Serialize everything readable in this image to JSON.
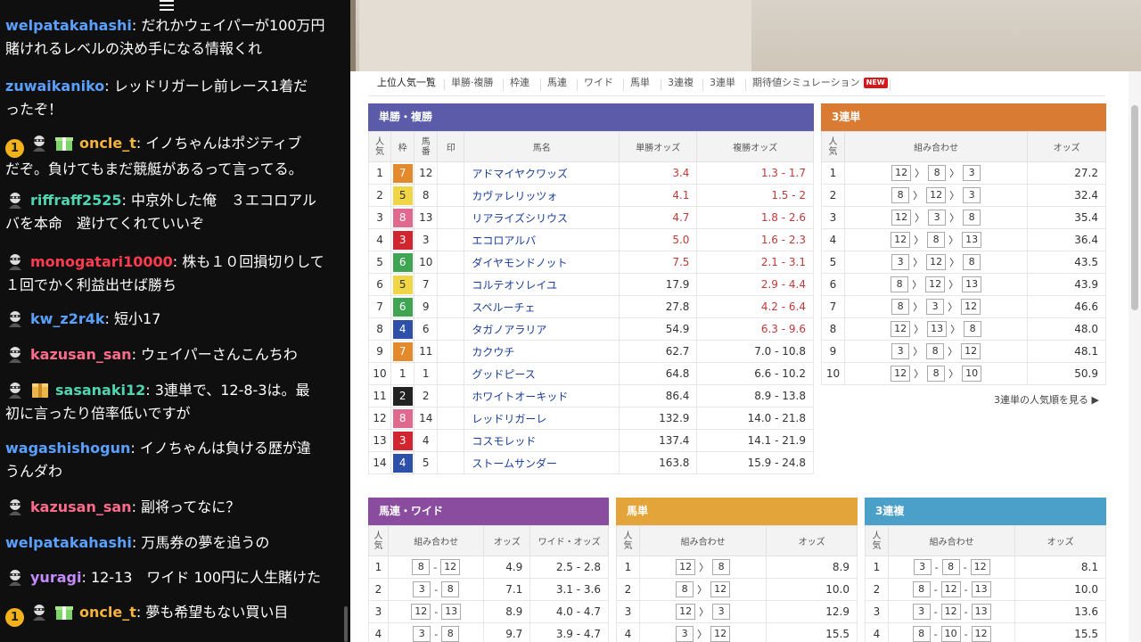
{
  "chat": {
    "messages": [
      {
        "badges": [],
        "user": "welpatakahashi",
        "color": "#5aa0ff",
        "lines": [
          "だれかウェイパーが100万円",
          "賭けれるレベルの決め手になる情報くれ"
        ]
      },
      {
        "badges": [],
        "user": "zuwaikaniko",
        "color": "#5aa0ff",
        "lines": [
          "レッドリガーレ前レース1着だ",
          "ったぞ！"
        ]
      },
      {
        "badges": [
          "1",
          "ninja",
          "gift"
        ],
        "user": "oncle_t",
        "color": "#f5b33b",
        "lines": [
          "イノちゃんはポジティブ",
          "だぞ。負けてもまだ競艇があるって言ってる。"
        ]
      },
      {
        "badges": [
          "ninja"
        ],
        "user": "riffraff2525",
        "color": "#4fd6b0",
        "lines": [
          "中京外した俺　３エコロアル",
          "バを本命　避けてくれていいぞ"
        ]
      },
      {
        "badges": [
          "ninja"
        ],
        "user": "monogatari10000",
        "color": "#ff3b4f",
        "lines": [
          "株も１０回損切りして",
          "１回でかく利益出せば勝ち"
        ]
      },
      {
        "badges": [
          "ninja"
        ],
        "user": "kw_z2r4k",
        "color": "#5aa0ff",
        "lines": [
          "短小17"
        ]
      },
      {
        "badges": [
          "ninja"
        ],
        "user": "kazusan_san",
        "color": "#ff6b8b",
        "lines": [
          "ウェイパーさんこんちわ"
        ]
      },
      {
        "badges": [
          "ninja",
          "box"
        ],
        "user": "sasanaki12",
        "color": "#4fd6b0",
        "lines": [
          "3連単で、12-8-3は。最",
          "初に言ったり倍率低いですが"
        ]
      },
      {
        "badges": [],
        "user": "wagashishogun",
        "color": "#5aa0ff",
        "lines": [
          "イノちゃんは負ける歴が違",
          "うんダわ"
        ]
      },
      {
        "badges": [
          "ninja"
        ],
        "user": "kazusan_san",
        "color": "#ff6b8b",
        "lines": [
          "副将ってなに？"
        ]
      },
      {
        "badges": [],
        "user": "welpatakahashi",
        "color": "#5aa0ff",
        "lines": [
          "万馬券の夢を追うの"
        ]
      },
      {
        "badges": [
          "ninja"
        ],
        "user": "yuragi",
        "color": "#c48bff",
        "lines": [
          "12-13　ワイド 100円に人生賭けた"
        ]
      },
      {
        "badges": [
          "1",
          "ninja",
          "gift"
        ],
        "user": "oncle_t",
        "color": "#f5b33b",
        "lines": [
          "夢も希望もない買い目"
        ]
      }
    ]
  },
  "tabs": [
    {
      "label": "上位人気一覧",
      "active": true
    },
    {
      "label": "単勝·複勝"
    },
    {
      "label": "枠連"
    },
    {
      "label": "馬連"
    },
    {
      "label": "ワイド"
    },
    {
      "label": "馬単"
    },
    {
      "label": "3連複"
    },
    {
      "label": "3連単"
    },
    {
      "label": "期待値シミュレーション",
      "new": "NEW"
    }
  ],
  "win": {
    "title": "単勝・複勝",
    "color": "#5b5ba9",
    "headers": [
      "人気",
      "枠",
      "馬番",
      "印",
      "馬名",
      "単勝オッズ",
      "複勝オッズ"
    ],
    "rows": [
      [
        "1",
        "7",
        "12",
        "",
        "アドマイヤクワッズ",
        "3.4",
        "1.3 - 1.7"
      ],
      [
        "2",
        "5",
        "8",
        "",
        "カヴァレリッツォ",
        "4.1",
        "1.5 - 2"
      ],
      [
        "3",
        "8",
        "13",
        "",
        "リアライズシリウス",
        "4.7",
        "1.8 - 2.6"
      ],
      [
        "4",
        "3",
        "3",
        "",
        "エコロアルバ",
        "5.0",
        "1.6 - 2.3"
      ],
      [
        "5",
        "6",
        "10",
        "",
        "ダイヤモンドノット",
        "7.5",
        "2.1 - 3.1"
      ],
      [
        "6",
        "5",
        "7",
        "",
        "コルテオソレイユ",
        "17.9",
        "2.9 - 4.4"
      ],
      [
        "7",
        "6",
        "9",
        "",
        "スペルーチェ",
        "27.8",
        "4.2 - 6.4"
      ],
      [
        "8",
        "4",
        "6",
        "",
        "タガノアラリア",
        "54.9",
        "6.3 - 9.6"
      ],
      [
        "9",
        "7",
        "11",
        "",
        "カクウチ",
        "62.7",
        "7.0 - 10.8"
      ],
      [
        "10",
        "1",
        "1",
        "",
        "グッドピース",
        "64.8",
        "6.6 - 10.2"
      ],
      [
        "11",
        "2",
        "2",
        "",
        "ホワイトオーキッド",
        "86.4",
        "8.9 - 13.8"
      ],
      [
        "12",
        "8",
        "14",
        "",
        "レッドリガーレ",
        "132.9",
        "14.0 - 21.8"
      ],
      [
        "13",
        "3",
        "4",
        "",
        "コスモレッド",
        "137.4",
        "14.1 - 21.9"
      ],
      [
        "14",
        "4",
        "5",
        "",
        "ストームサンダー",
        "163.8",
        "15.9 - 24.8"
      ]
    ],
    "red_win_rows": 5,
    "red_place_rows": 8
  },
  "waku_colors": {
    "1": "#ffffff",
    "2": "#222222",
    "3": "#d1262f",
    "4": "#2f50a8",
    "5": "#f0d646",
    "6": "#3fa553",
    "7": "#e58a2c",
    "8": "#e06a8f"
  },
  "trifecta": {
    "title": "3連単",
    "color": "#d97b32",
    "headers": [
      "人気",
      "組み合わせ",
      "オッズ"
    ],
    "rows": [
      [
        "1",
        [
          "12",
          "8",
          "3"
        ],
        "27.2"
      ],
      [
        "2",
        [
          "8",
          "12",
          "3"
        ],
        "32.4"
      ],
      [
        "3",
        [
          "12",
          "3",
          "8"
        ],
        "35.4"
      ],
      [
        "4",
        [
          "12",
          "8",
          "13"
        ],
        "36.4"
      ],
      [
        "5",
        [
          "3",
          "12",
          "8"
        ],
        "43.5"
      ],
      [
        "6",
        [
          "8",
          "12",
          "13"
        ],
        "43.9"
      ],
      [
        "7",
        [
          "8",
          "3",
          "12"
        ],
        "46.6"
      ],
      [
        "8",
        [
          "12",
          "13",
          "8"
        ],
        "48.0"
      ],
      [
        "9",
        [
          "3",
          "8",
          "12"
        ],
        "48.1"
      ],
      [
        "10",
        [
          "12",
          "8",
          "10"
        ],
        "50.9"
      ]
    ],
    "more": "3連単の人気順を見る"
  },
  "quinella": {
    "title": "馬連・ワイド",
    "color": "#8a4c9f",
    "headers": [
      "人気",
      "組み合わせ",
      "オッズ",
      "ワイド・オッズ"
    ],
    "rows": [
      [
        "1",
        [
          "8",
          "12"
        ],
        "4.9",
        "2.5 - 2.8"
      ],
      [
        "2",
        [
          "3",
          "8"
        ],
        "7.1",
        "3.1 - 3.6"
      ],
      [
        "3",
        [
          "12",
          "13"
        ],
        "8.9",
        "4.0 - 4.7"
      ],
      [
        "4",
        [
          "3",
          "8"
        ],
        "9.7",
        "3.9 - 4.7"
      ]
    ]
  },
  "exacta": {
    "title": "馬単",
    "color": "#e3a43a",
    "headers": [
      "人気",
      "組み合わせ",
      "オッズ"
    ],
    "rows": [
      [
        "1",
        [
          "12",
          "8"
        ],
        "8.9"
      ],
      [
        "2",
        [
          "8",
          "12"
        ],
        "10.0"
      ],
      [
        "3",
        [
          "12",
          "3"
        ],
        "12.9"
      ],
      [
        "4",
        [
          "3",
          "12"
        ],
        "15.5"
      ]
    ]
  },
  "trio": {
    "title": "3連複",
    "color": "#4aa0c8",
    "headers": [
      "人気",
      "組み合わせ",
      "オッズ"
    ],
    "rows": [
      [
        "1",
        [
          "3",
          "8",
          "12"
        ],
        "8.1"
      ],
      [
        "2",
        [
          "8",
          "12",
          "13"
        ],
        "10.0"
      ],
      [
        "3",
        [
          "3",
          "12",
          "13"
        ],
        "13.6"
      ],
      [
        "4",
        [
          "8",
          "10",
          "12"
        ],
        "15.5"
      ]
    ]
  }
}
